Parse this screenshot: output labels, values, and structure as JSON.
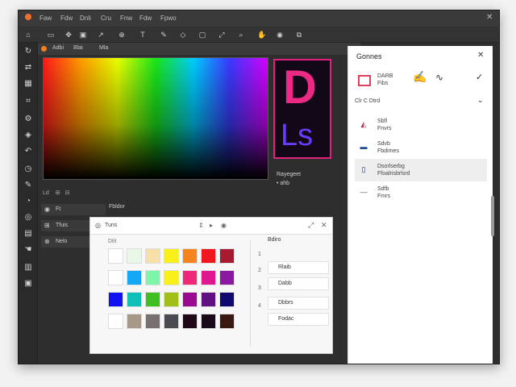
{
  "menubar": {
    "items": [
      "Faw",
      "Fdw",
      "Dnli",
      "Cru",
      "Fnw",
      "Fdw",
      "Fpwo"
    ]
  },
  "toolbar": {
    "icons": [
      "home-icon",
      "layers-icon",
      "move-icon",
      "image-icon",
      "arrow-icon",
      "move-icon",
      "text-icon",
      "brush-icon",
      "shape-icon",
      "frame-icon",
      "transform-icon",
      "zoom-icon",
      "pan-icon",
      "preview-icon",
      "frame-icon"
    ]
  },
  "optbar": {
    "items": [
      "Adbi",
      "Blai",
      "Mla"
    ]
  },
  "canvas": {
    "info": [
      "Ld",
      "⊞",
      "⊟"
    ]
  },
  "logo": {
    "d": "D",
    "ls": "Ls"
  },
  "preview_caption": {
    "line1": "Rayegeet",
    "line2": "• ahb"
  },
  "left_panel": {
    "header": "Fbldor",
    "items": [
      "Ft",
      "Tfuis",
      "Nelo"
    ]
  },
  "swatch_dialog": {
    "title": "Tuns",
    "section": "Dtit",
    "swatches": [
      "#ffffff",
      "#e8f7e8",
      "#f7e0a8",
      "#f7f01a",
      "#f5841f",
      "#f0181f",
      "#a81a30",
      "#ffffff",
      "#17a8f5",
      "#7ef5a8",
      "#f7f01a",
      "#f02878",
      "#e0188f",
      "#8c1aa0",
      "#1010f0",
      "#10c0b8",
      "#40c020",
      "#a0c018",
      "#9a0a90",
      "#601080",
      "#100a70",
      "#ffffff",
      "#a89888",
      "#787070",
      "#4a4a52",
      "#200818",
      "#180a18",
      "#3a1a10"
    ],
    "list_header": "Bdiro",
    "list": [
      {
        "num": "1",
        "label": "Rlaib"
      },
      {
        "num": "2",
        "label": "Dabb"
      },
      {
        "num": "3",
        "label": "Dbbrs"
      },
      {
        "num": "4",
        "label": "Fodac"
      }
    ]
  },
  "right_panel": {
    "title": "Gonnes",
    "items": [
      {
        "label": "DARB",
        "sub": "Fibs",
        "selected": false
      },
      {
        "label": "Clr  C  Dtrd",
        "sub": "",
        "selected": false
      },
      {
        "label": "Sbfl",
        "sub": "Fnvrs",
        "selected": false
      },
      {
        "label": "Sdvb",
        "sub": "Fbdimes",
        "selected": false
      },
      {
        "label": "Dsorlserbg",
        "sub": "Ffoalrisbrlsrd",
        "selected": true
      },
      {
        "label": "Sdfb",
        "sub": "Fmrs",
        "selected": false
      }
    ]
  }
}
